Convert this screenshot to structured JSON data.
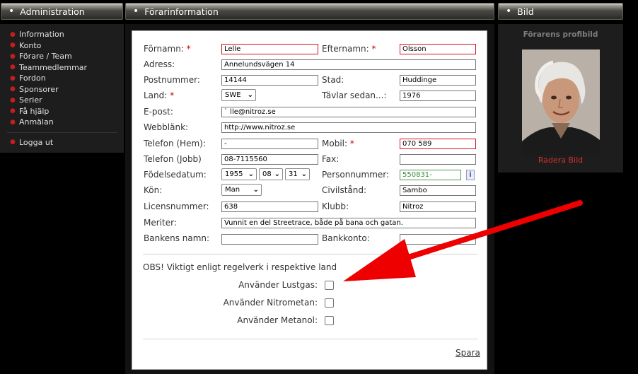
{
  "left": {
    "header": "Administration",
    "items": [
      "Information",
      "Konto",
      "Förare / Team",
      "Teammedlemmar",
      "Fordon",
      "Sponsorer",
      "Serier",
      "Få hjälp",
      "Anmälan"
    ],
    "logout": "Logga ut"
  },
  "main": {
    "header": "Förarinformation",
    "labels": {
      "fornamn": "Förnamn:",
      "efternamn": "Efternamn:",
      "adress": "Adress:",
      "postnummer": "Postnummer:",
      "stad": "Stad:",
      "land": "Land:",
      "tavlar": "Tävlar sedan...:",
      "epost": "E-post:",
      "webblank": "Webblänk:",
      "telefon_hem": "Telefon (Hem):",
      "mobil": "Mobil:",
      "telefon_jobb": "Telefon (Jobb)",
      "fax": "Fax:",
      "fodelsedatum": "Födelsedatum:",
      "personnummer": "Personnummer:",
      "kon": "Kön:",
      "civilstand": "Civilstånd:",
      "licensnummer": "Licensnummer:",
      "klubb": "Klubb:",
      "meriter": "Meriter:",
      "bankens_namn": "Bankens namn:",
      "bankkonto": "Bankkonto:"
    },
    "required_mark": "*",
    "values": {
      "fornamn": "Lelle",
      "efternamn": "Olsson",
      "adress": "Annelundsvägen 14",
      "postnummer": "14144",
      "stad": "Huddinge",
      "land": "SWE",
      "tavlar": "1976",
      "epost": "`  lle@nitroz.se",
      "webblank": "http://www.nitroz.se",
      "telefon_hem": "-",
      "mobil": "070 589",
      "telefon_jobb": "08-7115560",
      "fax": "",
      "fodelse_year": "1955",
      "fodelse_month": "08",
      "fodelse_day": "31",
      "personnummer": "550831-",
      "kon": "Man",
      "civilstand": "Sambo",
      "licensnummer": "638",
      "klubb": "Nitroz",
      "meriter": "Vunnit en del Streetrace, både på bana och gatan.",
      "bankens_namn": "",
      "bankkonto": ""
    },
    "info_glyph": "i",
    "obs_text": "OBS! Viktigt enligt regelverk i respektive land",
    "checkboxes": [
      "Använder Lustgas:",
      "Använder Nitrometan:",
      "Använder Metanol:"
    ],
    "save": "Spara"
  },
  "right": {
    "header": "Bild",
    "profile_title": "Förarens profibild",
    "delete": "Radera Bild"
  },
  "colors": {
    "accent_red": "#d4131b",
    "arrow_red": "#ee0000"
  }
}
